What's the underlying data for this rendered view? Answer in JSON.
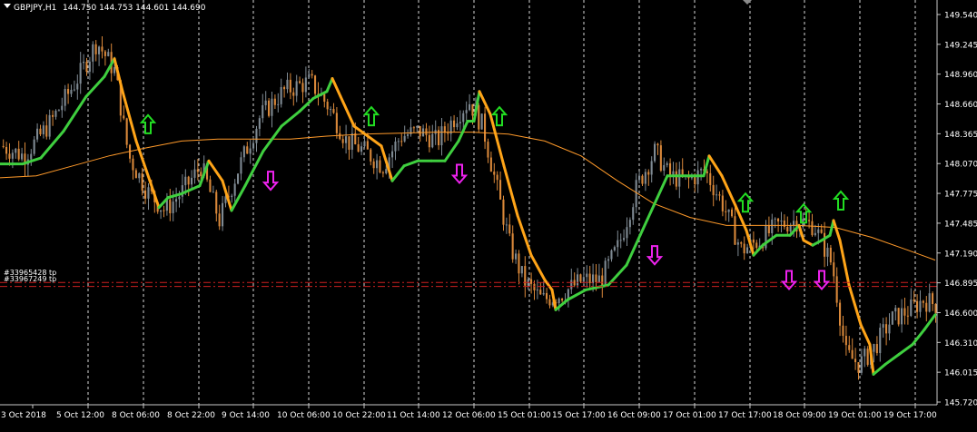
{
  "title": {
    "symbol_tf": "GBPJPY,H1",
    "ohlc": "144.750 144.753 144.601 144.690"
  },
  "colors": {
    "background": "#000000",
    "grid": "#ffffff",
    "axis": "#c8c8c8",
    "text": "#ffffff",
    "bull": "#7f8a93",
    "bear": "#d9883a",
    "ma_fast_up": "#3fcf3f",
    "ma_fast_down": "#ffa418",
    "ma_slow": "#ff9a2a",
    "arrow_up": "#22dd22",
    "arrow_down": "#ee22ee",
    "order_line": "#cc2020"
  },
  "order_lines": [
    {
      "label": "#33965428 tp",
      "price": 146.925
    },
    {
      "label": "#33967249 tp",
      "price": 146.885
    }
  ],
  "chart_data": {
    "type": "candlestick",
    "symbol": "GBPJPY",
    "timeframe": "H1",
    "ylim": [
      145.72,
      149.68
    ],
    "y_ticks": [
      "149.540",
      "149.245",
      "148.960",
      "148.660",
      "148.365",
      "148.070",
      "147.775",
      "147.485",
      "147.190",
      "146.895",
      "146.600",
      "146.310",
      "146.015",
      "145.720"
    ],
    "x_ticks": [
      "3 Oct 2018",
      "5 Oct 12:00",
      "8 Oct 06:00",
      "8 Oct 22:00",
      "9 Oct 14:00",
      "10 Oct 06:00",
      "10 Oct 22:00",
      "11 Oct 14:00",
      "12 Oct 06:00",
      "15 Oct 01:00",
      "15 Oct 17:00",
      "16 Oct 09:00",
      "17 Oct 01:00",
      "17 Oct 17:00",
      "18 Oct 09:00",
      "19 Oct 01:00",
      "19 Oct 17:00"
    ],
    "price_path": [
      [
        0,
        148.3
      ],
      [
        25,
        148.2
      ],
      [
        55,
        148.55
      ],
      [
        85,
        149.0
      ],
      [
        105,
        149.35
      ],
      [
        125,
        149.05
      ],
      [
        140,
        148.2
      ],
      [
        160,
        147.85
      ],
      [
        180,
        147.65
      ],
      [
        200,
        147.85
      ],
      [
        220,
        148.1
      ],
      [
        240,
        147.55
      ],
      [
        260,
        148.05
      ],
      [
        285,
        148.6
      ],
      [
        310,
        148.85
      ],
      [
        340,
        148.95
      ],
      [
        360,
        148.7
      ],
      [
        380,
        148.35
      ],
      [
        400,
        148.25
      ],
      [
        420,
        148.1
      ],
      [
        440,
        148.4
      ],
      [
        460,
        148.45
      ],
      [
        480,
        148.35
      ],
      [
        500,
        148.6
      ],
      [
        515,
        148.75
      ],
      [
        530,
        148.5
      ],
      [
        545,
        147.9
      ],
      [
        560,
        147.3
      ],
      [
        575,
        146.95
      ],
      [
        595,
        146.75
      ],
      [
        615,
        146.8
      ],
      [
        640,
        146.95
      ],
      [
        660,
        146.95
      ],
      [
        680,
        147.3
      ],
      [
        700,
        147.9
      ],
      [
        720,
        148.25
      ],
      [
        735,
        148.0
      ],
      [
        755,
        147.95
      ],
      [
        775,
        148.05
      ],
      [
        795,
        147.7
      ],
      [
        815,
        147.25
      ],
      [
        835,
        147.35
      ],
      [
        855,
        147.5
      ],
      [
        875,
        147.55
      ],
      [
        895,
        147.5
      ],
      [
        915,
        147.1
      ],
      [
        930,
        146.2
      ],
      [
        945,
        146.1
      ],
      [
        960,
        146.25
      ],
      [
        980,
        146.55
      ],
      [
        1000,
        146.65
      ],
      [
        1015,
        146.75
      ],
      [
        1030,
        146.7
      ]
    ],
    "ma_fast": [
      [
        0,
        148.12
      ],
      [
        25,
        148.12
      ],
      [
        45,
        148.18
      ],
      [
        70,
        148.45
      ],
      [
        95,
        148.8
      ],
      [
        115,
        149.0
      ],
      [
        126,
        149.18
      ],
      [
        135,
        148.85
      ],
      [
        150,
        148.35
      ],
      [
        165,
        147.95
      ],
      [
        175,
        147.68
      ],
      [
        185,
        147.78
      ],
      [
        200,
        147.82
      ],
      [
        220,
        147.9
      ],
      [
        230,
        148.15
      ],
      [
        245,
        147.95
      ],
      [
        255,
        147.65
      ],
      [
        270,
        147.9
      ],
      [
        290,
        148.25
      ],
      [
        310,
        148.5
      ],
      [
        330,
        148.65
      ],
      [
        345,
        148.78
      ],
      [
        360,
        148.85
      ],
      [
        366,
        148.98
      ],
      [
        375,
        148.8
      ],
      [
        390,
        148.5
      ],
      [
        405,
        148.4
      ],
      [
        420,
        148.3
      ],
      [
        432,
        147.95
      ],
      [
        445,
        148.1
      ],
      [
        460,
        148.15
      ],
      [
        475,
        148.15
      ],
      [
        490,
        148.15
      ],
      [
        505,
        148.35
      ],
      [
        515,
        148.55
      ],
      [
        522,
        148.55
      ],
      [
        528,
        148.85
      ],
      [
        540,
        148.62
      ],
      [
        555,
        148.1
      ],
      [
        570,
        147.6
      ],
      [
        585,
        147.2
      ],
      [
        600,
        146.95
      ],
      [
        608,
        146.85
      ],
      [
        612,
        146.65
      ],
      [
        625,
        146.75
      ],
      [
        645,
        146.85
      ],
      [
        670,
        146.9
      ],
      [
        690,
        147.1
      ],
      [
        705,
        147.4
      ],
      [
        720,
        147.7
      ],
      [
        735,
        148.0
      ],
      [
        755,
        148.0
      ],
      [
        775,
        148.0
      ],
      [
        781,
        148.2
      ],
      [
        795,
        148.0
      ],
      [
        810,
        147.7
      ],
      [
        822,
        147.45
      ],
      [
        830,
        147.2
      ],
      [
        840,
        147.3
      ],
      [
        855,
        147.4
      ],
      [
        870,
        147.4
      ],
      [
        880,
        147.5
      ],
      [
        885,
        147.35
      ],
      [
        895,
        147.3
      ],
      [
        905,
        147.35
      ],
      [
        914,
        147.4
      ],
      [
        918,
        147.55
      ],
      [
        925,
        147.35
      ],
      [
        935,
        146.9
      ],
      [
        948,
        146.5
      ],
      [
        958,
        146.3
      ],
      [
        962,
        146.0
      ],
      [
        975,
        146.1
      ],
      [
        990,
        146.2
      ],
      [
        1005,
        146.3
      ],
      [
        1018,
        146.45
      ],
      [
        1030,
        146.6
      ]
    ],
    "ma_slow": [
      [
        0,
        147.98
      ],
      [
        40,
        148.0
      ],
      [
        80,
        148.1
      ],
      [
        120,
        148.2
      ],
      [
        160,
        148.28
      ],
      [
        200,
        148.35
      ],
      [
        240,
        148.37
      ],
      [
        280,
        148.37
      ],
      [
        320,
        148.37
      ],
      [
        360,
        148.4
      ],
      [
        400,
        148.42
      ],
      [
        440,
        148.43
      ],
      [
        480,
        148.44
      ],
      [
        520,
        148.44
      ],
      [
        560,
        148.42
      ],
      [
        600,
        148.35
      ],
      [
        640,
        148.2
      ],
      [
        680,
        147.95
      ],
      [
        720,
        147.72
      ],
      [
        760,
        147.58
      ],
      [
        800,
        147.5
      ],
      [
        840,
        147.5
      ],
      [
        880,
        147.5
      ],
      [
        920,
        147.48
      ],
      [
        960,
        147.38
      ],
      [
        1000,
        147.25
      ],
      [
        1030,
        147.15
      ]
    ],
    "signals": [
      {
        "direction": "up",
        "x": 163,
        "price": 148.52
      },
      {
        "direction": "down",
        "x": 298,
        "price": 147.95
      },
      {
        "direction": "up",
        "x": 409,
        "price": 148.6
      },
      {
        "direction": "down",
        "x": 506,
        "price": 148.02
      },
      {
        "direction": "up",
        "x": 550,
        "price": 148.6
      },
      {
        "direction": "down",
        "x": 721,
        "price": 147.2
      },
      {
        "direction": "up",
        "x": 821,
        "price": 147.73
      },
      {
        "direction": "down",
        "x": 869,
        "price": 146.95
      },
      {
        "direction": "up",
        "x": 885,
        "price": 147.62
      },
      {
        "direction": "down",
        "x": 905,
        "price": 146.95
      },
      {
        "direction": "up",
        "x": 926,
        "price": 147.75
      }
    ]
  }
}
